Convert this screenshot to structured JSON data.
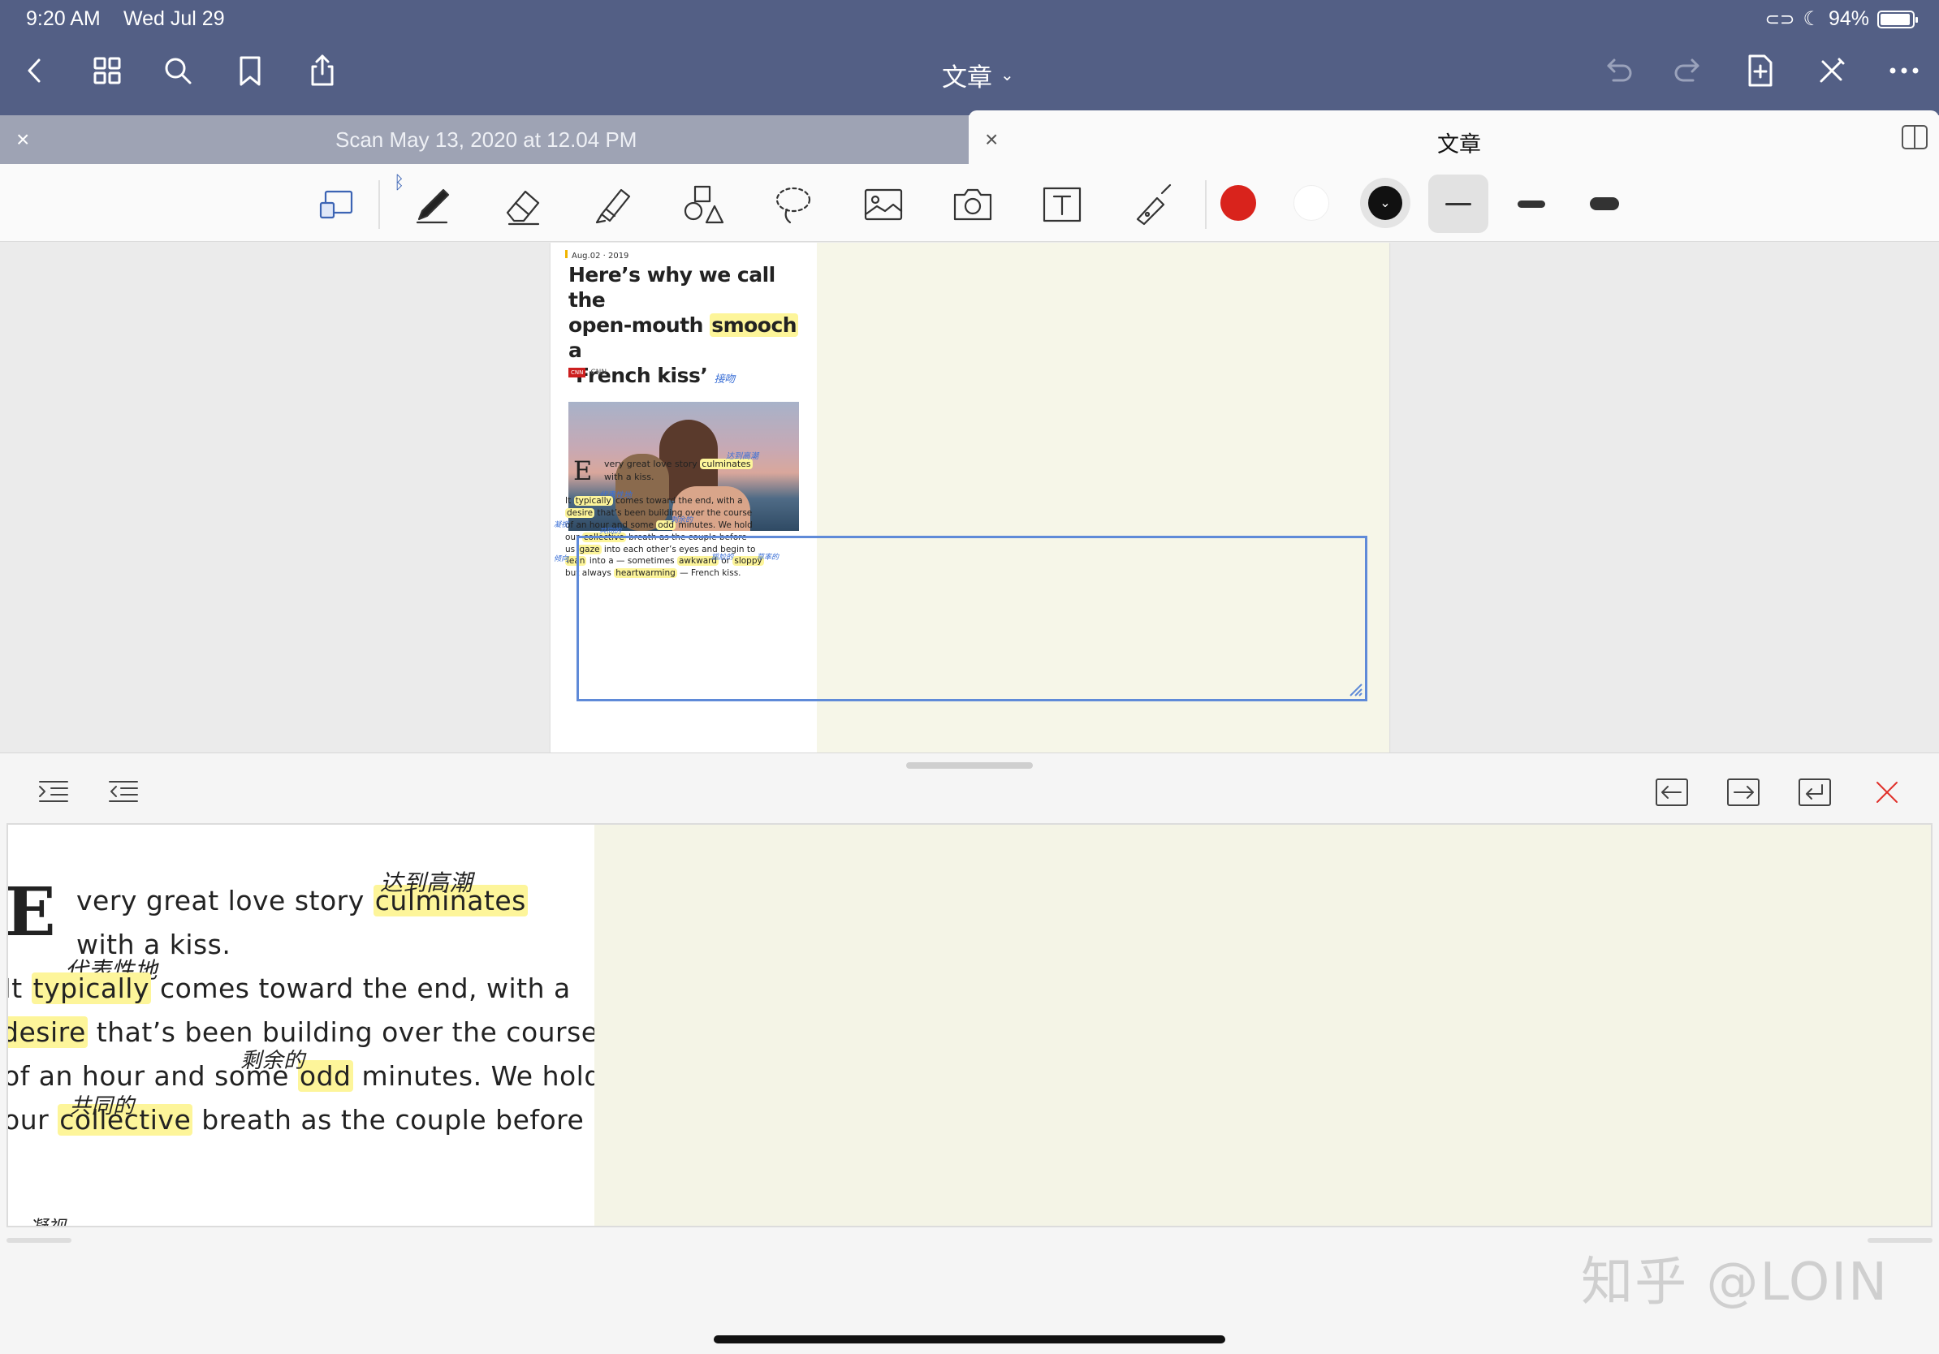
{
  "status": {
    "time": "9:20 AM",
    "date": "Wed Jul 29",
    "battery": "94%",
    "battery_level": 0.94
  },
  "nav": {
    "doc_title": "文章",
    "back_icon": "chevron-left-icon",
    "grid_icon": "grid-icon",
    "search_icon": "search-icon",
    "bookmark_icon": "bookmark-icon",
    "share_icon": "share-icon",
    "undo_icon": "undo-icon",
    "redo_icon": "redo-icon",
    "add_page_icon": "add-page-icon",
    "pen_off_icon": "pen-off-icon",
    "more_icon": "more-icon"
  },
  "tabs": [
    {
      "label": "Scan May 13, 2020 at 12.04 PM",
      "active": false
    },
    {
      "label": "文章",
      "active": true
    }
  ],
  "toolbar": {
    "tools": [
      "zoom-window-icon",
      "pen-icon",
      "eraser-icon",
      "highlighter-icon",
      "shapes-icon",
      "lasso-icon",
      "image-icon",
      "camera-icon",
      "text-icon",
      "laser-pointer-icon"
    ],
    "bluetooth_icon": "bluetooth-icon",
    "colors": [
      "#d9231c",
      "#ffffff",
      "#111111"
    ],
    "selected_color": "#111111",
    "widths": [
      "thin",
      "medium",
      "thick"
    ],
    "selected_width": "thin"
  },
  "article": {
    "date": "Aug.02 · 2019",
    "title_line1": "Here’s why we call the",
    "title_line2_a": "open-mouth",
    "title_line2_hl": "smooch",
    "title_line2_b": "a",
    "title_line3": "‘French kiss’",
    "title_note": "接吻",
    "source_badge": "CNN",
    "source": "CNN",
    "drop_cap": "E",
    "p1_line1": "very great love story",
    "p1_hl": "culminates",
    "p1_line2": "with a kiss.",
    "p1_note": "达到高潮",
    "p2": [
      {
        "pre": "It",
        "hl": "typically",
        "post": "comes toward the end, with a"
      },
      {
        "pre": "",
        "hl": "desire",
        "post": "that’s been building over the course"
      },
      {
        "pre": "of an hour and some",
        "hl": "odd",
        "post": "minutes. We hold"
      },
      {
        "pre": "our",
        "hl": "collective",
        "post": "breath as the couple before"
      },
      {
        "pre": "us",
        "hl": "gaze",
        "post": "into each other’s eyes and begin to"
      },
      {
        "pre": "",
        "hl": "lean",
        "post": "into a — sometimes"
      },
      {
        "pre": "but always",
        "hl": "heartwarming",
        "post": "— French kiss."
      }
    ],
    "p2_hl_extra": [
      "awkward",
      "sloppy"
    ],
    "p2_notes": [
      "代表性地",
      "剩余的",
      "共同的",
      "凝视",
      "倾向",
      "尴尬的",
      "草率的",
      "暖心的"
    ]
  },
  "zoom": {
    "indent_icon": "indent-increase-icon",
    "outdent_icon": "indent-decrease-icon",
    "move_left_icon": "move-left-icon",
    "move_right_icon": "move-right-icon",
    "new_line_icon": "return-icon",
    "close_icon": "close-icon",
    "close_color": "#e0302a"
  },
  "watermark": "知乎 @LOIN"
}
